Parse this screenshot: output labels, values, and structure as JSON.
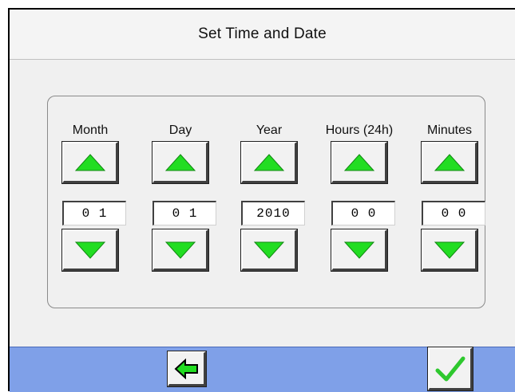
{
  "title": "Set Time and Date",
  "columns": [
    {
      "label": "Month",
      "value": "0 1"
    },
    {
      "label": "Day",
      "value": "0 1"
    },
    {
      "label": "Year",
      "value": "2010"
    },
    {
      "label": "Hours (24h)",
      "value": "0 0"
    },
    {
      "label": "Minutes",
      "value": "0 0"
    }
  ],
  "icons": {
    "up": "triangle-up-icon",
    "down": "triangle-down-icon",
    "back": "back-arrow-icon",
    "confirm": "checkmark-icon"
  },
  "colors": {
    "arrow_green": "#22dd22",
    "bottom_bar": "#7fa0e8",
    "check_green": "#2ec82e"
  }
}
